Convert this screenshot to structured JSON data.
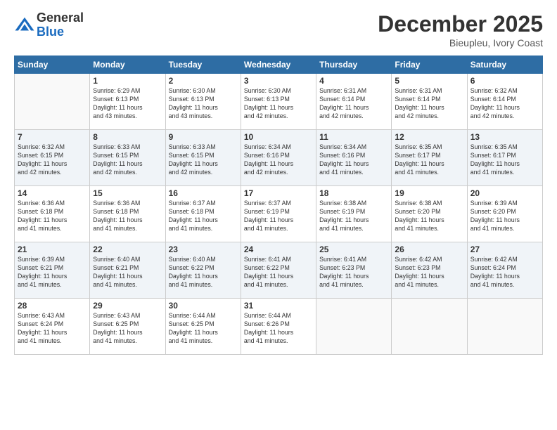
{
  "logo": {
    "general": "General",
    "blue": "Blue"
  },
  "header": {
    "month": "December 2025",
    "location": "Bieupleu, Ivory Coast"
  },
  "weekdays": [
    "Sunday",
    "Monday",
    "Tuesday",
    "Wednesday",
    "Thursday",
    "Friday",
    "Saturday"
  ],
  "weeks": [
    [
      {
        "day": "",
        "info": ""
      },
      {
        "day": "1",
        "info": "Sunrise: 6:29 AM\nSunset: 6:13 PM\nDaylight: 11 hours\nand 43 minutes."
      },
      {
        "day": "2",
        "info": "Sunrise: 6:30 AM\nSunset: 6:13 PM\nDaylight: 11 hours\nand 43 minutes."
      },
      {
        "day": "3",
        "info": "Sunrise: 6:30 AM\nSunset: 6:13 PM\nDaylight: 11 hours\nand 42 minutes."
      },
      {
        "day": "4",
        "info": "Sunrise: 6:31 AM\nSunset: 6:14 PM\nDaylight: 11 hours\nand 42 minutes."
      },
      {
        "day": "5",
        "info": "Sunrise: 6:31 AM\nSunset: 6:14 PM\nDaylight: 11 hours\nand 42 minutes."
      },
      {
        "day": "6",
        "info": "Sunrise: 6:32 AM\nSunset: 6:14 PM\nDaylight: 11 hours\nand 42 minutes."
      }
    ],
    [
      {
        "day": "7",
        "info": "Sunrise: 6:32 AM\nSunset: 6:15 PM\nDaylight: 11 hours\nand 42 minutes."
      },
      {
        "day": "8",
        "info": "Sunrise: 6:33 AM\nSunset: 6:15 PM\nDaylight: 11 hours\nand 42 minutes."
      },
      {
        "day": "9",
        "info": "Sunrise: 6:33 AM\nSunset: 6:15 PM\nDaylight: 11 hours\nand 42 minutes."
      },
      {
        "day": "10",
        "info": "Sunrise: 6:34 AM\nSunset: 6:16 PM\nDaylight: 11 hours\nand 42 minutes."
      },
      {
        "day": "11",
        "info": "Sunrise: 6:34 AM\nSunset: 6:16 PM\nDaylight: 11 hours\nand 41 minutes."
      },
      {
        "day": "12",
        "info": "Sunrise: 6:35 AM\nSunset: 6:17 PM\nDaylight: 11 hours\nand 41 minutes."
      },
      {
        "day": "13",
        "info": "Sunrise: 6:35 AM\nSunset: 6:17 PM\nDaylight: 11 hours\nand 41 minutes."
      }
    ],
    [
      {
        "day": "14",
        "info": "Sunrise: 6:36 AM\nSunset: 6:18 PM\nDaylight: 11 hours\nand 41 minutes."
      },
      {
        "day": "15",
        "info": "Sunrise: 6:36 AM\nSunset: 6:18 PM\nDaylight: 11 hours\nand 41 minutes."
      },
      {
        "day": "16",
        "info": "Sunrise: 6:37 AM\nSunset: 6:18 PM\nDaylight: 11 hours\nand 41 minutes."
      },
      {
        "day": "17",
        "info": "Sunrise: 6:37 AM\nSunset: 6:19 PM\nDaylight: 11 hours\nand 41 minutes."
      },
      {
        "day": "18",
        "info": "Sunrise: 6:38 AM\nSunset: 6:19 PM\nDaylight: 11 hours\nand 41 minutes."
      },
      {
        "day": "19",
        "info": "Sunrise: 6:38 AM\nSunset: 6:20 PM\nDaylight: 11 hours\nand 41 minutes."
      },
      {
        "day": "20",
        "info": "Sunrise: 6:39 AM\nSunset: 6:20 PM\nDaylight: 11 hours\nand 41 minutes."
      }
    ],
    [
      {
        "day": "21",
        "info": "Sunrise: 6:39 AM\nSunset: 6:21 PM\nDaylight: 11 hours\nand 41 minutes."
      },
      {
        "day": "22",
        "info": "Sunrise: 6:40 AM\nSunset: 6:21 PM\nDaylight: 11 hours\nand 41 minutes."
      },
      {
        "day": "23",
        "info": "Sunrise: 6:40 AM\nSunset: 6:22 PM\nDaylight: 11 hours\nand 41 minutes."
      },
      {
        "day": "24",
        "info": "Sunrise: 6:41 AM\nSunset: 6:22 PM\nDaylight: 11 hours\nand 41 minutes."
      },
      {
        "day": "25",
        "info": "Sunrise: 6:41 AM\nSunset: 6:23 PM\nDaylight: 11 hours\nand 41 minutes."
      },
      {
        "day": "26",
        "info": "Sunrise: 6:42 AM\nSunset: 6:23 PM\nDaylight: 11 hours\nand 41 minutes."
      },
      {
        "day": "27",
        "info": "Sunrise: 6:42 AM\nSunset: 6:24 PM\nDaylight: 11 hours\nand 41 minutes."
      }
    ],
    [
      {
        "day": "28",
        "info": "Sunrise: 6:43 AM\nSunset: 6:24 PM\nDaylight: 11 hours\nand 41 minutes."
      },
      {
        "day": "29",
        "info": "Sunrise: 6:43 AM\nSunset: 6:25 PM\nDaylight: 11 hours\nand 41 minutes."
      },
      {
        "day": "30",
        "info": "Sunrise: 6:44 AM\nSunset: 6:25 PM\nDaylight: 11 hours\nand 41 minutes."
      },
      {
        "day": "31",
        "info": "Sunrise: 6:44 AM\nSunset: 6:26 PM\nDaylight: 11 hours\nand 41 minutes."
      },
      {
        "day": "",
        "info": ""
      },
      {
        "day": "",
        "info": ""
      },
      {
        "day": "",
        "info": ""
      }
    ]
  ]
}
